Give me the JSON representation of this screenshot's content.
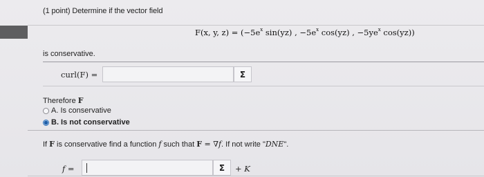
{
  "problem": {
    "header": "(1 point) Determine if the vector field",
    "equation_text": "F(x, y, z) = (−5e",
    "equation": {
      "lhs": "F(x, y, z) = (",
      "t1": "−5e",
      "t1_sup": "x",
      "t1_tail": " sin(yz) , ",
      "t2": "−5e",
      "t2_sup": "x",
      "t2_tail": " cos(yz) , ",
      "t3": "−5ye",
      "t3_sup": "x",
      "t3_tail": " cos(yz))"
    },
    "is_conservative": "is conservative."
  },
  "curl": {
    "label": "curl(F) =",
    "value": "",
    "sigma": "Σ"
  },
  "therefore": {
    "prefix": "Therefore ",
    "bold": "F"
  },
  "options": [
    {
      "label": "A. Is conservative",
      "selected": false
    },
    {
      "label": "B. Is not conservative",
      "selected": true
    }
  ],
  "instruction": {
    "p1": "If ",
    "F1": "F",
    "p2": " is conservative find a function ",
    "f": "f",
    "p3": " such that ",
    "F2": "F",
    "eq": " = ∇",
    "f2": "f",
    "p4": ". If not write \"",
    "dne": "DNE",
    "p5": "\"."
  },
  "answer": {
    "label": "f =",
    "value": "",
    "sigma": "Σ",
    "plus": "+ ",
    "k": "K"
  }
}
